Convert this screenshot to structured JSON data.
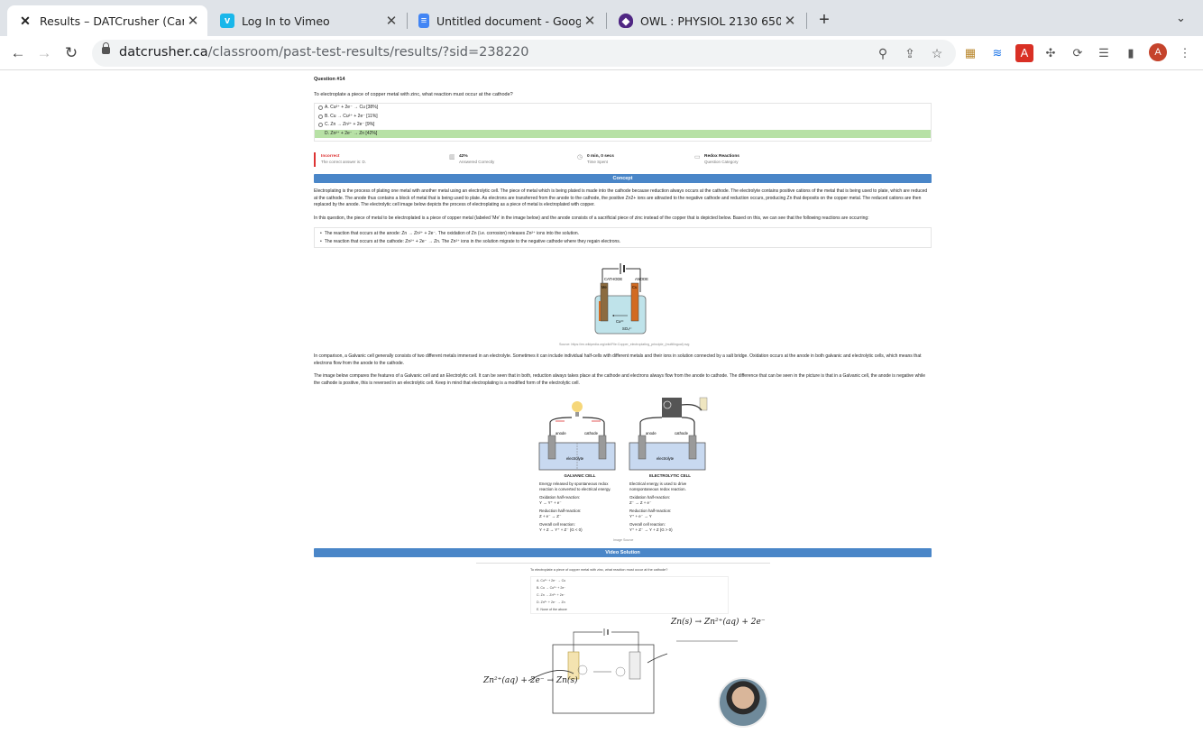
{
  "browser": {
    "tabs": [
      {
        "title": "Results – DATCrusher (Canadia",
        "icon": "datcrusher-icon",
        "active": true
      },
      {
        "title": "Log In to Vimeo",
        "icon": "vimeo-icon",
        "active": false
      },
      {
        "title": "Untitled document - Google Do",
        "icon": "google-docs-icon",
        "active": false
      },
      {
        "title": "OWL : PHYSIOL 2130 650 SU2",
        "icon": "owl-icon",
        "active": false
      }
    ],
    "new_tab": "+",
    "url_host": "datcrusher.ca",
    "url_path": "/classroom/past-test-results/results/?sid=238220",
    "avatar_letter": "A"
  },
  "question": {
    "number": "Question #14",
    "text": "To electroplate a piece of copper metal with zinc, what reaction must occur at the cathode?",
    "choices": [
      {
        "label": "A. Cu²⁺ + 2e⁻ → Cu  [38%]",
        "correct": false
      },
      {
        "label": "B. Cu → Cu²⁺ + 2e⁻  [11%]",
        "correct": false
      },
      {
        "label": "C. Zn → Zn²⁺ + 2e⁻  [9%]",
        "correct": false
      },
      {
        "label": "D. Zn²⁺ + 2e⁻ → Zn [42%]",
        "correct": true
      }
    ]
  },
  "result": {
    "status": "Incorrect",
    "status_sub": "The correct answer is: D.",
    "percent": "42%",
    "percent_sub": "Answered Correctly",
    "time": "0 min, 0 secs",
    "time_sub": "Time Spent",
    "category": "Redox Reactions",
    "category_sub": "Question Category"
  },
  "concept": {
    "header": "Concept",
    "p1": "Electroplating is the process of plating one metal with another metal using an electrolytic cell. The piece of metal which is being plated is made into the cathode because reduction always occurs at the cathode. The electrolyte contains positive cations of the metal that is being used to plate, which are reduced at the cathode. The anode thus contains a block of metal that is being used to plate. As electrons are transferred from the anode to the cathode, the positive Zn2+ ions are attracted to the negative cathode and reduction occurs, producing Zn that deposits on the copper metal. The reduced cations are then replaced by the anode. The electrolytic cell image below depicts the process of electroplating as a piece of metal is electroplated with copper.",
    "p2": "In this question, the piece of metal to be electroplated is a piece of copper metal (labeled 'Me' in the image below) and the anode consists of a sacrificial piece of zinc instead of the copper that is depicted below. Based on this, we can see that the following reactions are occurring:",
    "bullet1": "The reaction that occurs at the anode: Zn → Zn²⁺ + 2e⁻. The oxidation of Zn (i.e. corrosion) releases Zn²⁺ ions into the solution.",
    "bullet2": "The reaction that occurs at the cathode: Zn²⁺ + 2e⁻ → Zn. The Zn²⁺ ions in the solution migrate to the negative cathode where they regain electrons.",
    "diagram1": {
      "cathode": "CATHODE",
      "anode": "ANODE",
      "me": "Me",
      "cu": "Cu",
      "cu_ion": "Cu²⁺",
      "so4": "SO₄²⁻",
      "source": "Source: https://en.wikipedia.org/wiki/File:Copper_electroplating_principle_(multilingual).svg"
    },
    "p3": "In comparison, a Galvanic cell generally consists of two different metals immersed in an electrolyte. Sometimes it can include individual half-cells with different metals and their ions in solution connected by a salt bridge. Oxidation occurs at the anode in both galvanic and electrolytic cells, which means that electrons flow from the anode to the cathode.",
    "p4": "The image below compares the features of a Galvanic cell and an Electrolytic cell. It can be seen that in both, reduction always takes place at the cathode and electrons always flow from the anode to cathode. The difference that can be seen in the picture is that in a Galvanic cell, the anode is negative while the cathode is positive, this is reversed in an electrolytic cell. Keep in mind that electroplating is a modified form of the electrolytic cell.",
    "galvanic": {
      "title": "GALVANIC CELL",
      "anode": "anode",
      "cathode": "cathode",
      "electrolyte": "electrolyte",
      "desc": "Energy released by spontaneous redox reaction is converted to electrical energy.",
      "ox_label": "Oxidation half-reaction:",
      "ox": "Y → Y⁺ + e⁻",
      "red_label": "Reduction half-reaction:",
      "red": "Z + e⁻ → Z⁻",
      "overall_label": "Overall cell reaction:",
      "overall": "Y + Z → Y⁺ + Z⁻ (G < 0)"
    },
    "electrolytic": {
      "title": "ELECTROLYTIC CELL",
      "anode": "anode",
      "cathode": "cathode",
      "electrolyte": "electrolyte",
      "desc": "Electrical energy is used to drive nonspontaneous redox reaction.",
      "ox_label": "Oxidation half-reaction:",
      "ox": "Z⁻ → Z + e⁻",
      "red_label": "Reduction half-reaction:",
      "red": "Y⁺ + e⁻ → Y",
      "overall_label": "Overall cell reaction:",
      "overall": "Y⁺ + Z⁻ → Y + Z (G > 0)"
    },
    "image_source": "Image Source"
  },
  "video": {
    "header": "Video Solution",
    "question": "To electroplate a piece of copper metal with zinc, what reaction must occur at the cathode?",
    "options": [
      "A. Cu²⁺ + 2e⁻ → Cu",
      "B. Cu → Cu²⁺ + 2e⁻",
      "C. Zn → Zn²⁺ + 2e⁻",
      "D. Zn²⁺ + 2e⁻ → Zn",
      "E. None of the above"
    ],
    "hand_left": "Zn²⁺(aq) + 2e⁻ → Zn(s)",
    "hand_right": "Zn(s) → Zn²⁺(aq) + 2e⁻"
  }
}
